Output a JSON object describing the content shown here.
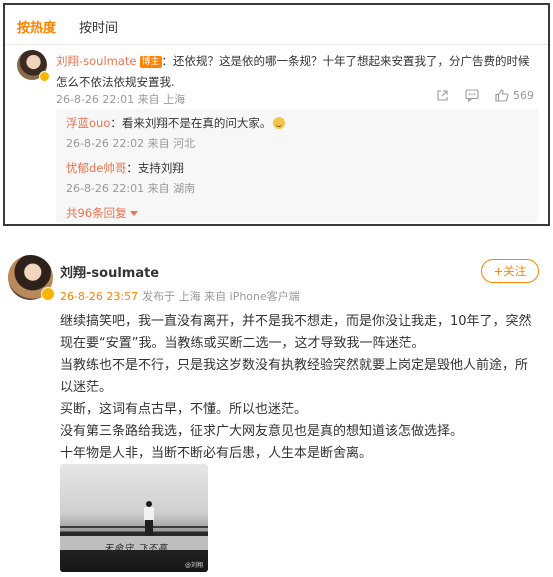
{
  "sort_tabs": {
    "hot": "按热度",
    "time": "按时间"
  },
  "top_comment": {
    "author": "刘翔-soulmate",
    "author_tag": "博主",
    "text": "：还依规？这是依的哪一条规？十年了想起来安置我了，分广告费的时候怎么不依法依规安置我.",
    "meta": "26-8-26 22:01 来自 上海",
    "like_count": "569",
    "replies": [
      {
        "author": "浮蓝ouo",
        "text": "：看来刘翔不是在真的问大家。",
        "meta": "26-8-26 22:02 来自 河北"
      },
      {
        "author": "忧郁de帅哥",
        "text": "：支持刘翔",
        "meta": "26-8-26 22:01 来自 湖南"
      }
    ],
    "more_replies": "共96条回复"
  },
  "post": {
    "author": "刘翔-soulmate",
    "time": "26-8-26 23:57",
    "source": "发布于 上海  来自 iPhone客户端",
    "follow_label": "+关注",
    "paragraphs": [
      "继续搞笑吧，我一直没有离开，并不是我不想走，而是你没让我走，10年了，突然现在要“安置”我。当教练或买断二选一，这才导致我一阵迷茫。",
      "当教练也不是不行，只是我这岁数没有执教经验突然就要上岗定是毁他人前途，所以迷茫。",
      "买断，这词有点古早，不懂。所以也迷茫。",
      "没有第三条路给我选，征求广大网友意见也是真的想知道该怎做选择。",
      "十年物是人非，当断不断必有后患，人生本是断舍离。"
    ],
    "image_caption": "天命守 飞不高",
    "image_watermark": "@刘翔"
  },
  "colors": {
    "accent": "#ff8200",
    "name": "#eb7350",
    "meta": "#999999",
    "reply_bg": "#f7f7f7"
  },
  "icons": [
    "share-icon",
    "comment-icon",
    "like-icon",
    "verified-badge-icon"
  ]
}
